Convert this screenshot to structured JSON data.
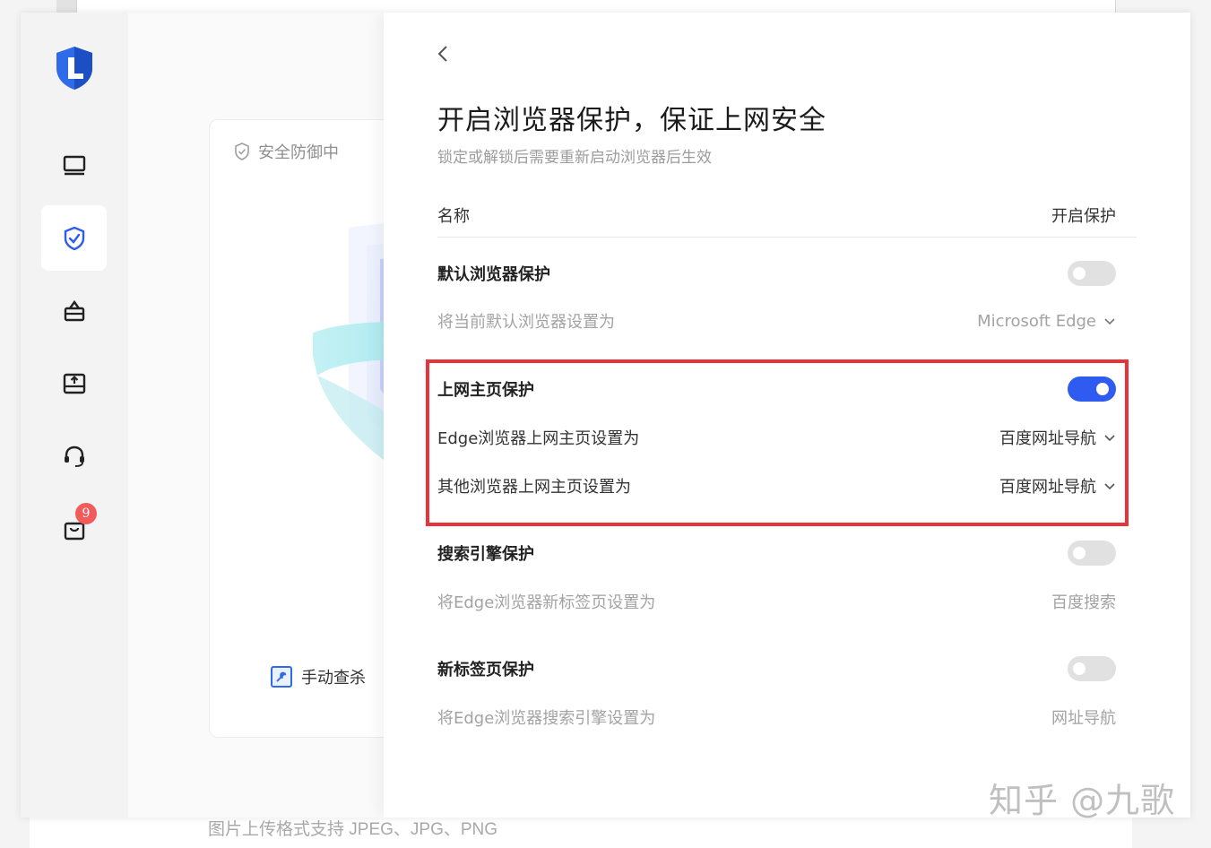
{
  "caption": "图片上传格式支持 JPEG、JPG、PNG",
  "watermark": "知乎 @九歌",
  "colors": {
    "accent": "#2f5bf0",
    "highlight": "#e7343a",
    "badge": "#f25b5b"
  },
  "sidebar": {
    "logo_icon": "shield-logo-icon",
    "items": [
      {
        "icon": "monitor-icon"
      },
      {
        "icon": "shield-check-icon",
        "active": true
      },
      {
        "icon": "toolbox-icon"
      },
      {
        "icon": "upload-box-icon"
      },
      {
        "icon": "headset-icon"
      },
      {
        "icon": "bag-icon",
        "badge": "9"
      }
    ]
  },
  "card": {
    "status": "安全防御中",
    "manual_scan": "手动查杀"
  },
  "panel": {
    "title": "开启浏览器保护，保证上网安全",
    "subtitle": "锁定或解锁后需要重新启动浏览器后生效",
    "header": {
      "name": "名称",
      "protect": "开启保护"
    },
    "sections": [
      {
        "title": "默认浏览器保护",
        "enabled": false,
        "sub": [
          {
            "label": "将当前默认浏览器设置为",
            "value": "Microsoft Edge"
          }
        ]
      },
      {
        "title": "上网主页保护",
        "enabled": true,
        "sub": [
          {
            "label": "Edge浏览器上网主页设置为",
            "value": "百度网址导航"
          },
          {
            "label": "其他浏览器上网主页设置为",
            "value": "百度网址导航"
          }
        ]
      },
      {
        "title": "搜索引擎保护",
        "enabled": false,
        "sub": [
          {
            "label": "将Edge浏览器新标签页设置为",
            "value": "百度搜索"
          }
        ]
      },
      {
        "title": "新标签页保护",
        "enabled": false,
        "sub": [
          {
            "label": "将Edge浏览器搜索引擎设置为",
            "value": "网址导航"
          }
        ]
      }
    ]
  }
}
